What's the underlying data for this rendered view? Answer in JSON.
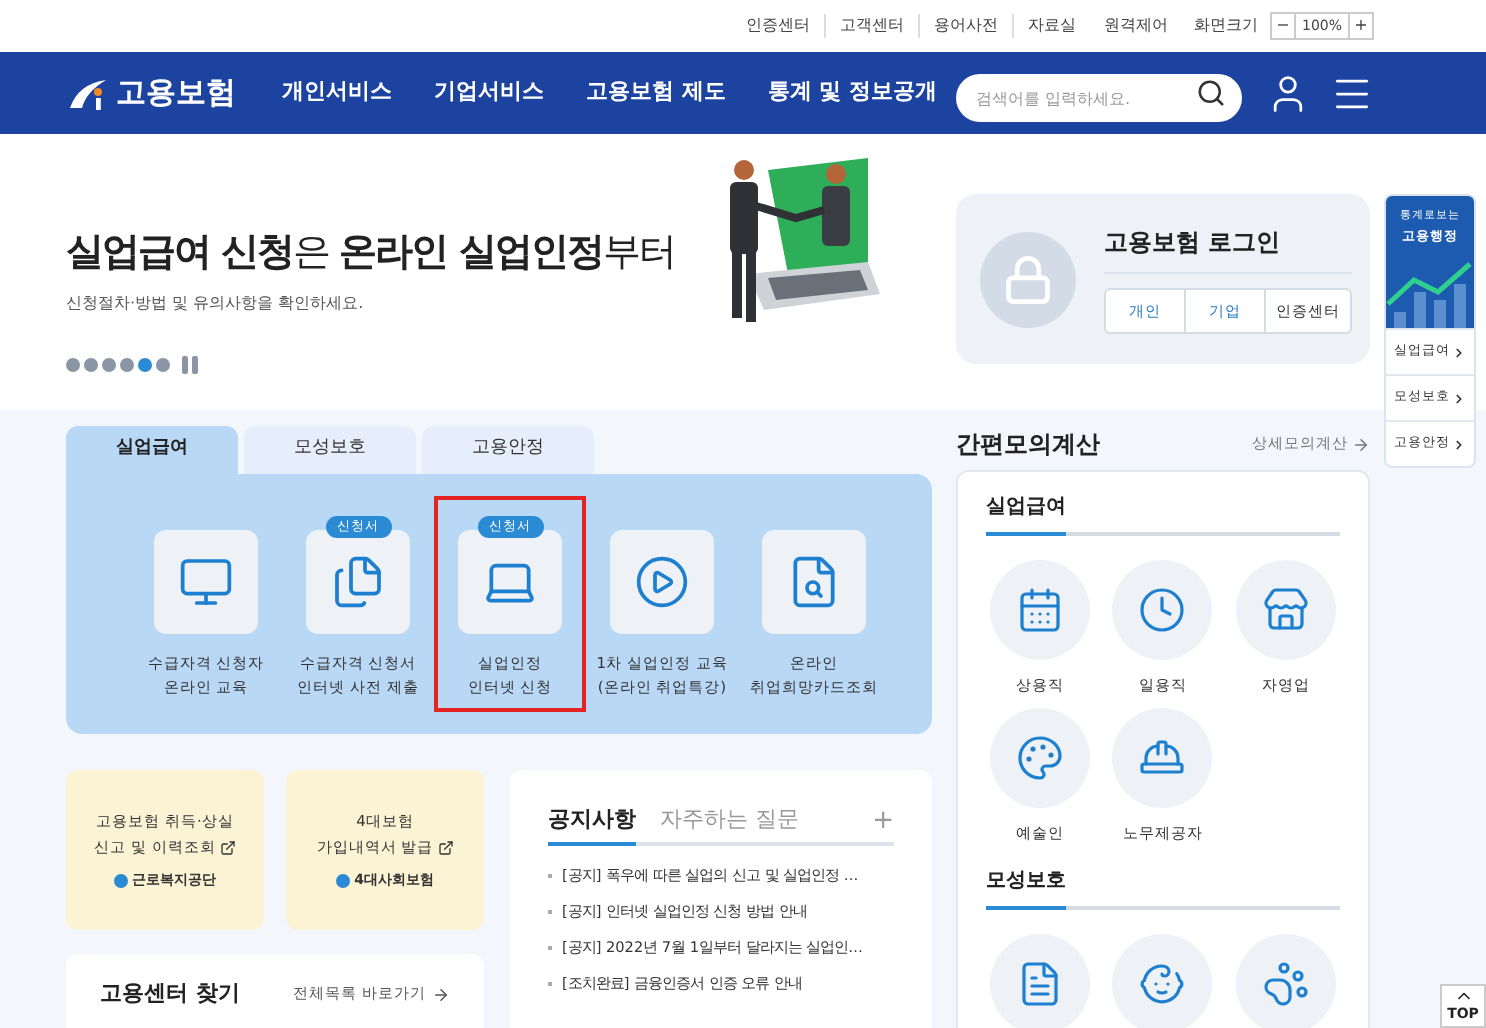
{
  "utility_links": [
    "인증센터",
    "고객센터",
    "용어사전",
    "자료실",
    "원격제어"
  ],
  "zoom": {
    "label": "화면크기",
    "minus": "−",
    "value": "100%",
    "plus": "+"
  },
  "header": {
    "logo": "고용보험",
    "nav": [
      "개인서비스",
      "기업서비스",
      "고용보험 제도",
      "통계 및 정보공개"
    ],
    "search": {
      "placeholder": "검색어를 입력하세요."
    }
  },
  "hero": {
    "title": "**실업급여 신청**은 **온라인 실업인정**부터",
    "subtitle": "신청절차·방법 및 유의사항을 확인하세요.",
    "slides": [
      {
        "selected": false
      },
      {
        "selected": false
      },
      {
        "selected": false
      },
      {
        "selected": false
      },
      {
        "selected": true
      },
      {
        "selected": false
      }
    ]
  },
  "login": {
    "title": "고용보험 로그인",
    "buttons": [
      "개인",
      "기업",
      "인증센터"
    ]
  },
  "side_widget": {
    "title_lines": [
      "통계로보는",
      "고용행정"
    ],
    "links": [
      "실업급여",
      "모성보호",
      "고용안정"
    ]
  },
  "tabs": [
    {
      "label": "실업급여",
      "selected": true
    },
    {
      "label": "모성보호",
      "selected": false
    },
    {
      "label": "고용안정",
      "selected": false
    }
  ],
  "services": [
    {
      "kind": "monitor",
      "lines": [
        "수급자격 신청자",
        "온라인 교육"
      ],
      "highlighted": false
    },
    {
      "kind": "documents",
      "badge": "신청서",
      "lines": [
        "수급자격 신청서",
        "인터넷 사전 제출"
      ],
      "highlighted": false
    },
    {
      "kind": "laptop",
      "badge": "신청서",
      "lines": [
        "실업인정",
        "인터넷 신청"
      ],
      "highlighted": true
    },
    {
      "kind": "video",
      "lines": [
        "1차 실업인정 교육",
        "(온라인 취업특강)"
      ],
      "highlighted": false
    },
    {
      "kind": "search",
      "lines": [
        "온라인",
        "취업희망카드조회"
      ],
      "highlighted": false
    }
  ],
  "quick_cards": [
    {
      "lines": [
        "고용보험 취득·상실",
        "신고 및 이력조회"
      ],
      "org": "근로복지공단"
    },
    {
      "lines": [
        "4대보험",
        "가입내역서 발급"
      ],
      "org": "4대사회보험"
    }
  ],
  "center_finder": {
    "title": "고용센터 찾기",
    "link": "전체목록 바로가기"
  },
  "notice": {
    "tabs": [
      {
        "label": "공지사항",
        "selected": true
      },
      {
        "label": "자주하는 질문",
        "selected": false
      }
    ],
    "plus": "+",
    "items": [
      "[공지] 폭우에 따른 실업의 신고 및 실업인정 …",
      "[공지] 인터넷 실업인정 신청 방법 안내",
      "[공지] 2022년 7월 1일부터 달라지는 실업인…",
      "[조치완료] 금융인증서 인증 오류 안내"
    ]
  },
  "calculator": {
    "title": "간편모의계산",
    "link": "상세모의계산",
    "sections": [
      {
        "title": "실업급여",
        "items": [
          {
            "kind": "calendar",
            "label": "상용직"
          },
          {
            "kind": "clock",
            "label": "일용직"
          },
          {
            "kind": "shop",
            "label": "자영업"
          },
          {
            "kind": "palette",
            "label": "예술인"
          },
          {
            "kind": "helmet",
            "label": "노무제공자"
          }
        ]
      },
      {
        "title": "모성보호",
        "items": [
          {
            "kind": "document"
          },
          {
            "kind": "baby"
          },
          {
            "kind": "bear"
          }
        ]
      }
    ]
  },
  "top_button": "TOP"
}
